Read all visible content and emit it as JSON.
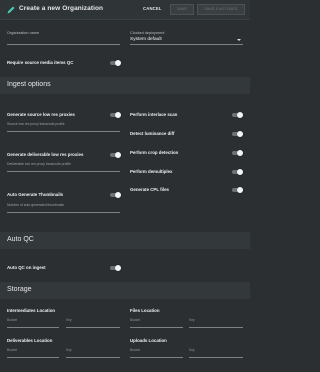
{
  "header": {
    "title": "Create a new Organization",
    "cancel_label": "CANCEL",
    "save_label": "SAVE",
    "save_launch_label": "SAVE & ACTIVATE",
    "pencil_icon": "pencil-icon"
  },
  "general": {
    "org_name_label": "Organization name",
    "org_name_value": "",
    "env_label": "Clocked deployment",
    "env_value": "System default",
    "require_qc_label": "Require source media items QC",
    "require_qc_on": false
  },
  "ingest": {
    "section_title": "Ingest options",
    "gen_source_label": "Generate source low res proxies",
    "gen_source_hint": "Source low res proxy transcode profile",
    "gen_source_on": false,
    "gen_deliv_label": "Generate deliverable low res proxies",
    "gen_deliv_hint": "Deliverable low res proxy transcode profile",
    "gen_deliv_on": false,
    "auto_thumb_label": "Auto Generate Thumbnails",
    "auto_thumb_hint": "Number of auto generated thumbnails",
    "auto_thumb_on": false,
    "interlace_label": "Perform interlace scan",
    "luminance_label": "Detect luminance diff",
    "crop_label": "Perform crop detection",
    "demultiplex_label": "Perform demultiplex",
    "cpl_label": "Generate CPL files"
  },
  "autoqc": {
    "section_title": "Auto QC",
    "on_ingest_label": "Auto QC on ingest",
    "on_ingest_on": false
  },
  "storage": {
    "section_title": "Storage",
    "intermediates_label": "Intermediates Location",
    "files_label": "Files Location",
    "deliverables_label": "Deliverables Location",
    "uploads_label": "Uploads Location",
    "bucket_label": "Bucket",
    "key_label": "Key"
  },
  "colors": {
    "background": "#2b2f32",
    "toggle_track": "#6d7276",
    "toggle_thumb": "#f4f4f4"
  }
}
